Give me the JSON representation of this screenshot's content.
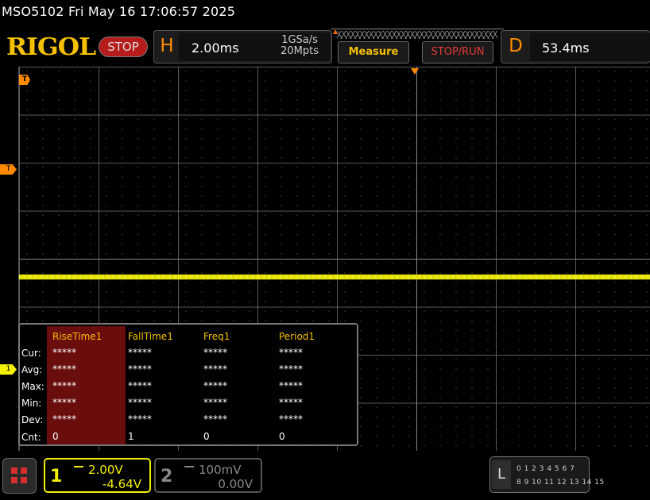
{
  "titlebar": {
    "text": "MSO5102  Fri May 16 17:06:57 2025"
  },
  "header": {
    "logo": "RIGOL",
    "run_state": "STOP",
    "horizontal": {
      "letter": "H",
      "timebase": "2.00ms",
      "sample_rate": "1GSa/s",
      "memory_depth": "20Mpts"
    },
    "measure_button": "Measure",
    "stoprun_button": "STOP/RUN",
    "delay": {
      "letter": "D",
      "value": "53.4ms"
    }
  },
  "markers": {
    "trigger_top": "T",
    "trigger_level": "T",
    "channel1": "1"
  },
  "measure_panel": {
    "columns": [
      "RiseTime1",
      "FallTime1",
      "Freq1",
      "Period1"
    ],
    "rows": [
      {
        "label": "Cur:",
        "values": [
          "*****",
          "*****",
          "*****",
          "*****"
        ]
      },
      {
        "label": "Avg:",
        "values": [
          "*****",
          "*****",
          "*****",
          "*****"
        ]
      },
      {
        "label": "Max:",
        "values": [
          "*****",
          "*****",
          "*****",
          "*****"
        ]
      },
      {
        "label": "Min:",
        "values": [
          "*****",
          "*****",
          "*****",
          "*****"
        ]
      },
      {
        "label": "Dev:",
        "values": [
          "*****",
          "*****",
          "*****",
          "*****"
        ]
      },
      {
        "label": "Cnt:",
        "values": [
          "0",
          "1",
          "0",
          "0"
        ]
      }
    ]
  },
  "channels": {
    "ch1": {
      "number": "1",
      "scale": "2.00V",
      "offset": "-4.64V",
      "color": "#f2f000"
    },
    "ch2": {
      "number": "2",
      "scale": "100mV",
      "offset": "0.00V",
      "color": "#888888"
    }
  },
  "logic": {
    "letter": "L",
    "row1": "0 1 2 3  4 5 6 7",
    "row2": "8 9 10 11 12 13 14 15"
  }
}
